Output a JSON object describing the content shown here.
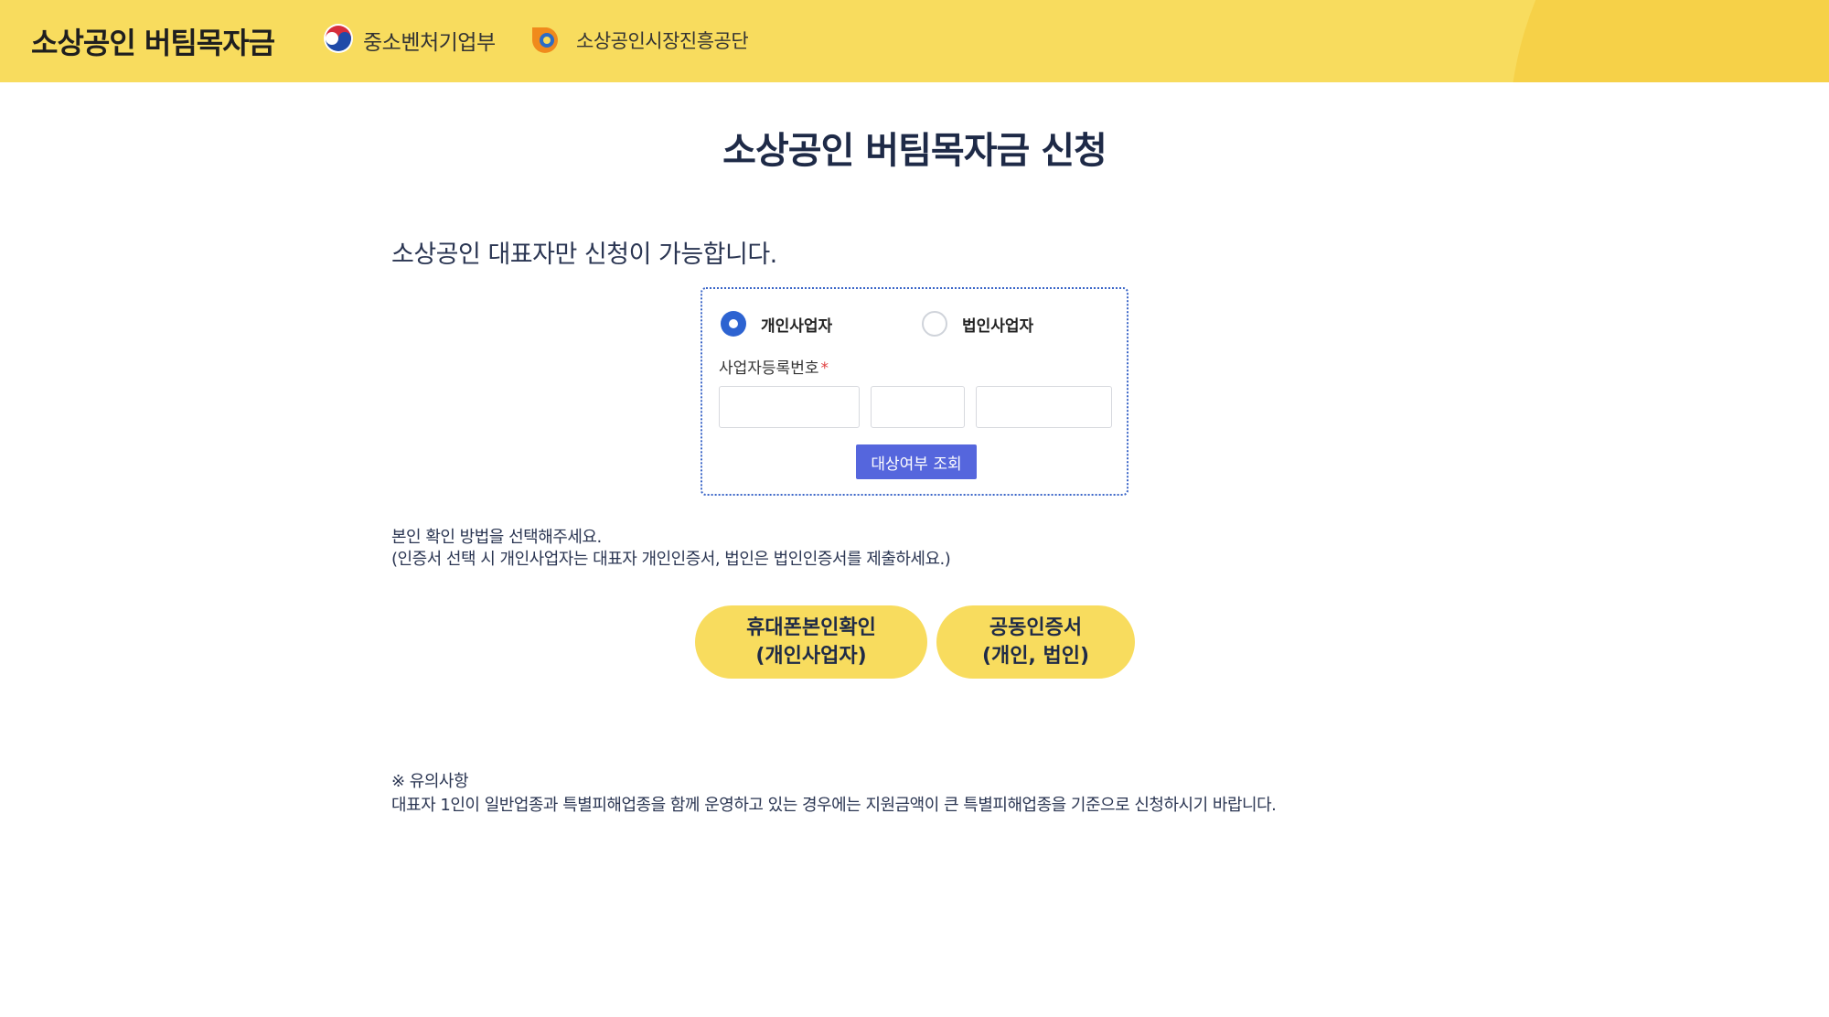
{
  "header": {
    "brand_title": "소상공인 버팀목자금",
    "ministry_label": "중소벤처기업부",
    "agency_label": "소상공인시장진흥공단"
  },
  "page": {
    "title": "소상공인 버팀목자금 신청",
    "eligibility_text": "소상공인 대표자만 신청이 가능합니다."
  },
  "form": {
    "business_types": [
      {
        "label": "개인사업자",
        "selected": true
      },
      {
        "label": "법인사업자",
        "selected": false
      }
    ],
    "brn_label": "사업자등록번호",
    "required_mark": "*",
    "brn_fields": [
      "",
      "",
      ""
    ],
    "check_button_label": "대상여부 조회"
  },
  "verification": {
    "line1": "본인 확인 방법을 선택해주세요.",
    "line2": "(인증서 선택 시 개인사업자는 대표자 개인인증서, 법인은 법인인증서를 제출하세요.)",
    "phone_button": {
      "line1": "휴대폰본인확인",
      "line2": "(개인사업자)"
    },
    "cert_button": {
      "line1": "공동인증서",
      "line2": "(개인, 법인)"
    }
  },
  "notice": {
    "title": "※ 유의사항",
    "body": "대표자 1인이 일반업종과 특별피해업종을 함께 운영하고 있는 경우에는 지원금액이 큰 특별피해업종을 기준으로 신청하시기 바랍니다."
  },
  "colors": {
    "header_bg": "#f8dc5e",
    "primary_blue": "#2d63d1",
    "button_blue": "#5566dd",
    "pill_yellow": "#f8dc5e",
    "title_navy": "#1e2a47"
  },
  "icons": {
    "ministry": "taegeuk-emblem-icon",
    "agency": "semas-logo-icon"
  }
}
